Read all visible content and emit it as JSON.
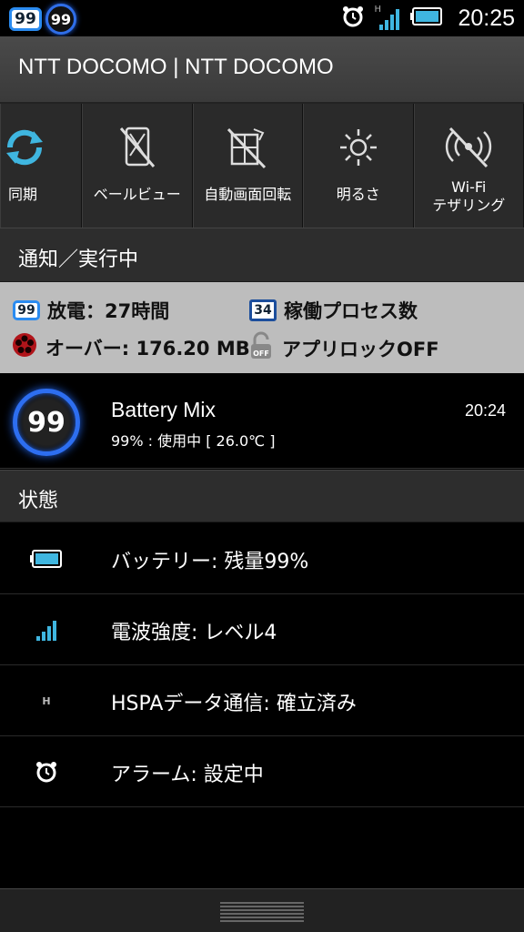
{
  "statusbar": {
    "badge_square": "99",
    "badge_round": "99",
    "network_letter": "H",
    "time": "20:25"
  },
  "carrier": {
    "title": "NTT DOCOMO | NTT DOCOMO"
  },
  "toggles": [
    {
      "icon": "sync-icon",
      "label": "同期"
    },
    {
      "icon": "veil-view-icon",
      "label": "ベールビュー"
    },
    {
      "icon": "auto-rotate-icon",
      "label": "自動画面回転"
    },
    {
      "icon": "brightness-icon",
      "label": "明るさ"
    },
    {
      "icon": "wifi-tethering-icon",
      "label_line1": "Wi-Fi",
      "label_line2": "テザリング"
    }
  ],
  "sections": {
    "notifications": "通知／実行中",
    "status": "状態"
  },
  "info": {
    "discharge_badge": "99",
    "discharge": "放電：27時間",
    "process_badge": "34",
    "process_count": "稼働プロセス数",
    "over": "オーバー: 176.20 MB",
    "applock": "アプリロックOFF"
  },
  "notification": {
    "badge": "99",
    "title": "Battery Mix",
    "subtitle": "99% : 使用中 [ 26.0℃ ]",
    "time": "20:24"
  },
  "status_rows": [
    {
      "icon": "battery-icon",
      "text": "バッテリー: 残量99%"
    },
    {
      "icon": "signal-icon",
      "text": "電波強度: レベル4"
    },
    {
      "icon": "hspa-icon",
      "icon_text": "H",
      "text": "HSPAデータ通信: 確立済み"
    },
    {
      "icon": "alarm-icon",
      "text": "アラーム: 設定中"
    }
  ],
  "colors": {
    "accent_blue": "#2d6ef0",
    "battery_cyan": "#3fb6e0",
    "panel_gray": "#bdbdbd"
  }
}
